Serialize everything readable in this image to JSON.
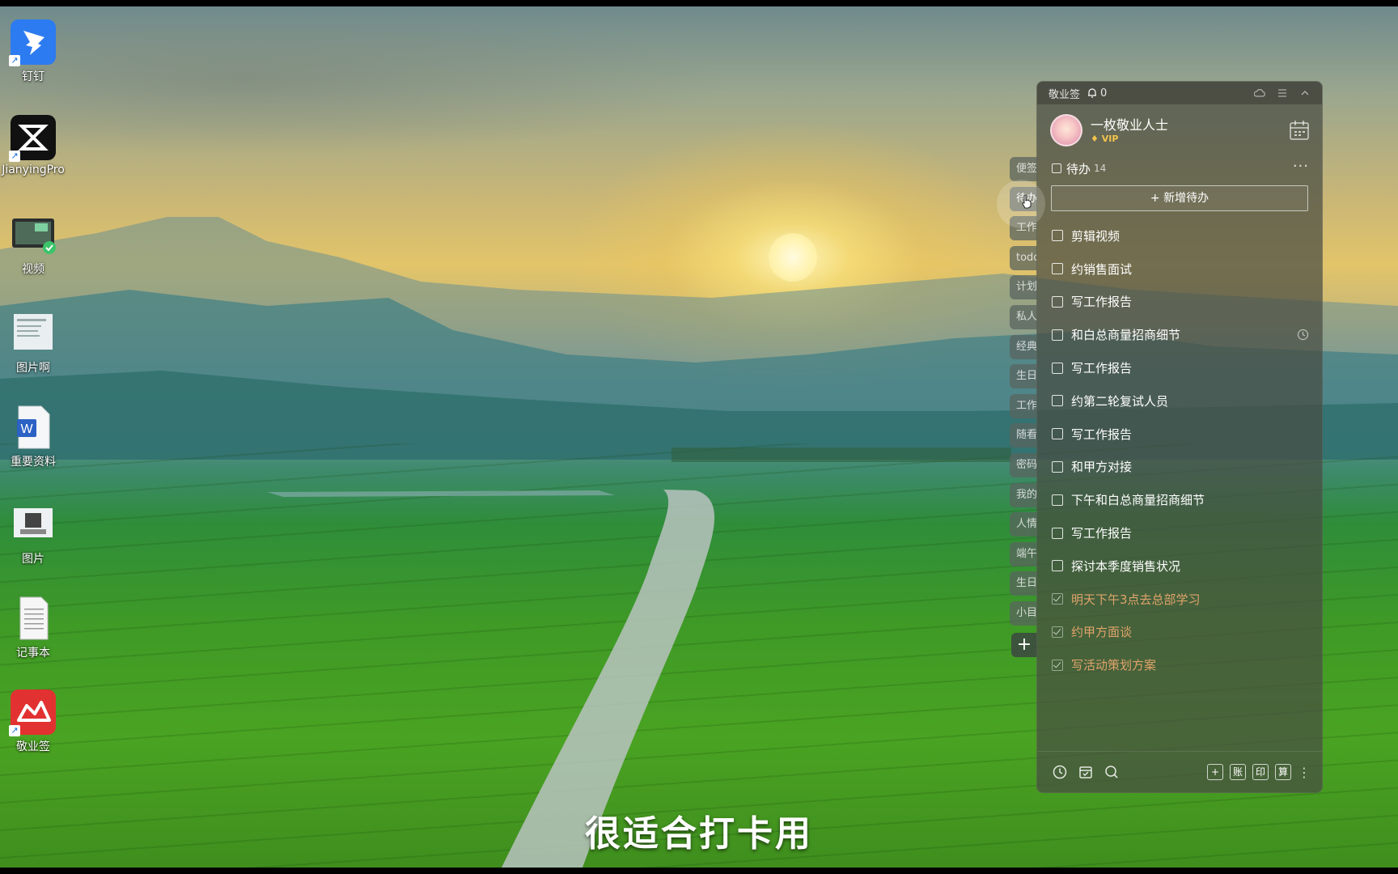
{
  "desktop": {
    "icons": [
      {
        "label": "钉钉",
        "icon": "dingtalk-icon"
      },
      {
        "label": "JianyingPro",
        "icon": "jianying-icon"
      },
      {
        "label": "视频",
        "icon": "video-folder-icon"
      },
      {
        "label": "图片啊",
        "icon": "image-doc-icon"
      },
      {
        "label": "重要资料",
        "icon": "word-doc-icon"
      },
      {
        "label": "图片",
        "icon": "image-icon"
      },
      {
        "label": "记事本",
        "icon": "notepad-icon"
      },
      {
        "label": "敬业签",
        "icon": "jingyeqian-icon"
      }
    ]
  },
  "side_tabs": [
    "便签",
    "待办",
    "工作",
    "todo",
    "计划",
    "私人",
    "经典",
    "生日",
    "工作",
    "随看",
    "密码",
    "我的",
    "人情",
    "端午",
    "生日",
    "小目"
  ],
  "side_add_label": "+",
  "panel": {
    "app_title": "敬业签",
    "reminder_count": "0",
    "user_name": "一枚敬业人士",
    "vip_label": "VIP",
    "section_title": "待办",
    "section_count": "14",
    "more_label": "···",
    "add_button_label": "+ 新增待办",
    "todos": [
      {
        "text": "剪辑视频",
        "done": false
      },
      {
        "text": "约销售面试",
        "done": false
      },
      {
        "text": "写工作报告",
        "done": false
      },
      {
        "text": "和白总商量招商细节",
        "done": false,
        "has_clock": true
      },
      {
        "text": "写工作报告",
        "done": false
      },
      {
        "text": "约第二轮复试人员",
        "done": false
      },
      {
        "text": "写工作报告",
        "done": false
      },
      {
        "text": "和甲方对接",
        "done": false
      },
      {
        "text": "下午和白总商量招商细节",
        "done": false
      },
      {
        "text": "写工作报告",
        "done": false
      },
      {
        "text": "探讨本季度销售状况",
        "done": false
      },
      {
        "text": "明天下午3点去总部学习",
        "done": true
      },
      {
        "text": "约甲方面谈",
        "done": true
      },
      {
        "text": "写活动策划方案",
        "done": true
      }
    ],
    "footer_buttons": [
      "账",
      "印",
      "算"
    ]
  },
  "subtitle": "很适合打卡用",
  "colors": {
    "done_text": "#e0a36a",
    "vip": "#f3c34b"
  }
}
